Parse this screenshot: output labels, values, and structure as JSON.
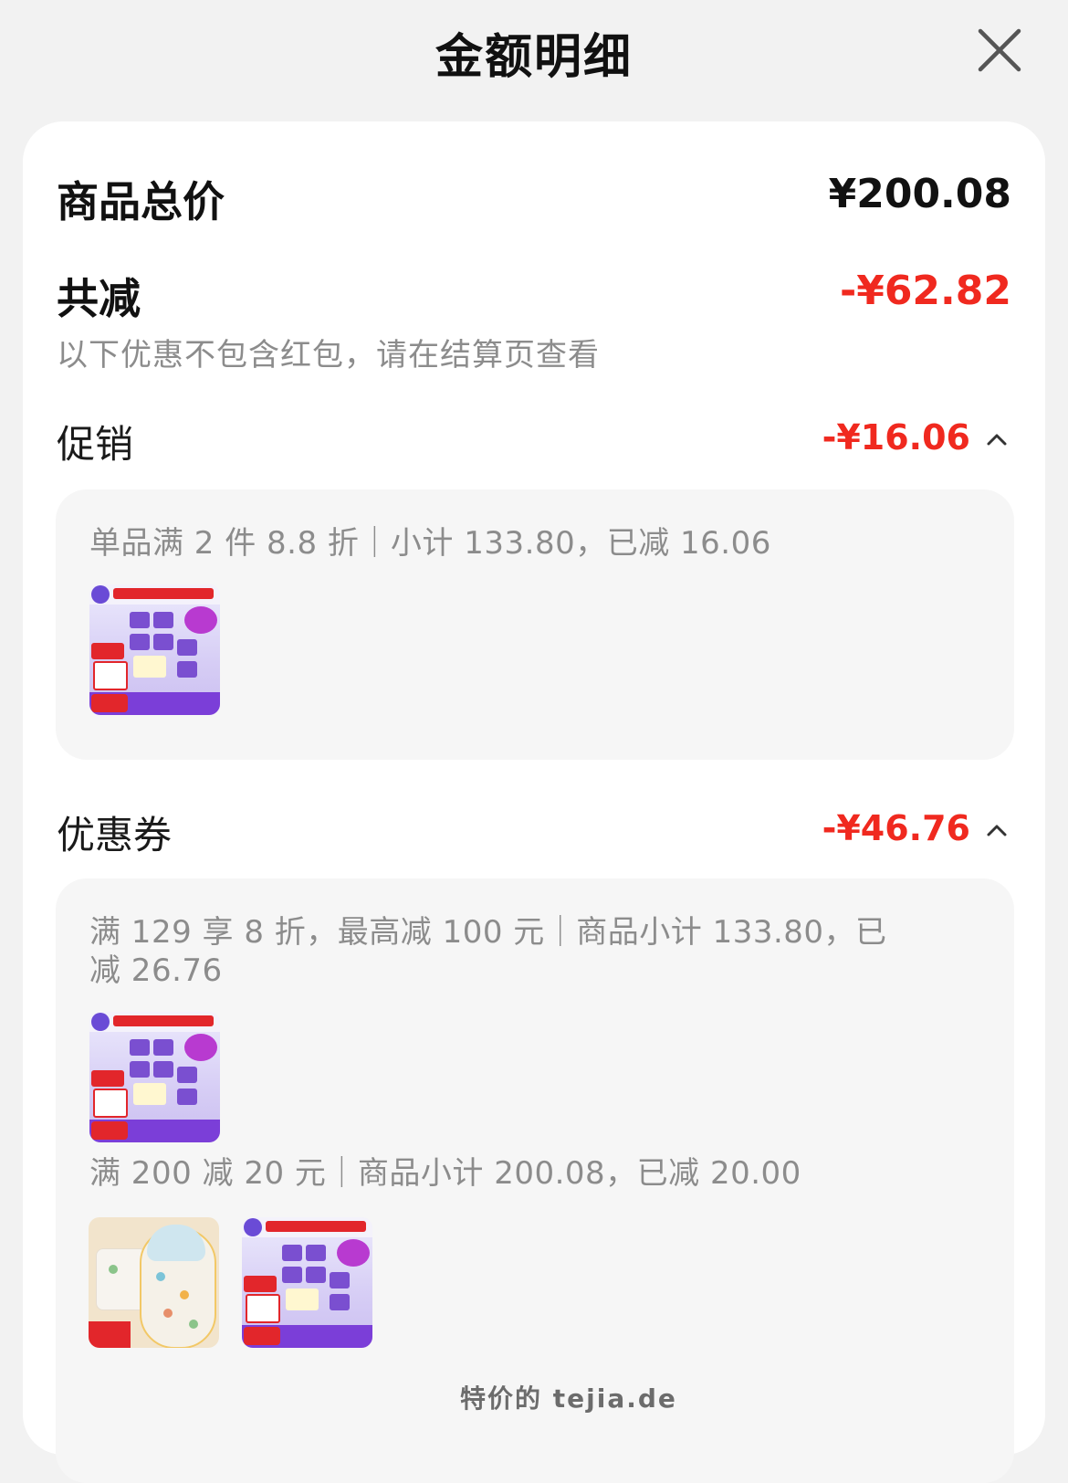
{
  "header": {
    "title": "金额明细"
  },
  "summary": {
    "total_label": "商品总价",
    "total_value": "¥200.08",
    "reduce_label": "共减",
    "reduce_value": "-¥62.82",
    "note": "以下优惠不包含红包，请在结算页查看"
  },
  "promotion": {
    "label": "促销",
    "value": "-¥16.06",
    "rules": [
      {
        "text": "单品满 2 件 8.8 折｜小计 133.80，已减 16.06",
        "products": [
          "tissue"
        ]
      }
    ]
  },
  "coupon": {
    "label": "优惠券",
    "value": "-¥46.76",
    "rules": [
      {
        "text": "满 129 享 8 折，最高减 100 元｜商品小计 133.80，已减 26.76",
        "products": [
          "tissue"
        ]
      },
      {
        "text": "满 200 减 20 元｜商品小计 200.08，已减 20.00",
        "products": [
          "sleeping-bag",
          "tissue"
        ]
      }
    ]
  },
  "watermark": "特价的 tejia.de",
  "colors": {
    "accent_red": "#f0291f",
    "text_primary": "#111111",
    "text_secondary": "#8c8c8c",
    "card_bg": "#ffffff",
    "box_bg": "#f6f6f6"
  },
  "icons": {
    "close": "close-icon",
    "collapse": "chevron-up-icon"
  }
}
